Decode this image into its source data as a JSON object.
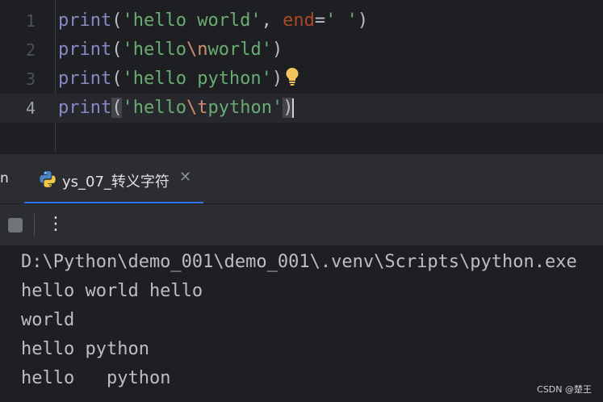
{
  "editor": {
    "lines": [
      {
        "number": "1",
        "fn": "print",
        "open": "(",
        "str1": "'hello world'",
        "sep": ", ",
        "kw": "end",
        "eq": "=",
        "str2": "' '",
        "close": ")"
      },
      {
        "number": "2",
        "fn": "print",
        "open": "(",
        "str_a": "'hello",
        "esc": "\\n",
        "str_b": "world'",
        "close": ")"
      },
      {
        "number": "3",
        "fn": "print",
        "open": "(",
        "str": "'hello python'",
        "close": ")"
      },
      {
        "number": "4",
        "fn": "print",
        "open": "(",
        "str_a": "'hello",
        "esc": "\\t",
        "str_b": "python'",
        "close": ")"
      }
    ],
    "current_line": 4,
    "intention_icon": "lightbulb-icon"
  },
  "tool_window": {
    "title_fragment": "n",
    "tab": {
      "icon": "python-icon",
      "label": "ys_07_转义字符",
      "close_icon": "close-icon"
    },
    "actions": {
      "stop_icon": "stop-icon",
      "more_icon": "more-vertical-icon"
    },
    "accent_color": "#3574f0"
  },
  "console": {
    "lines": [
      "D:\\Python\\demo_001\\demo_001\\.venv\\Scripts\\python.exe",
      "hello world hello",
      "world",
      "hello python",
      "hello\tpython"
    ]
  },
  "watermark": "CSDN @楚王"
}
